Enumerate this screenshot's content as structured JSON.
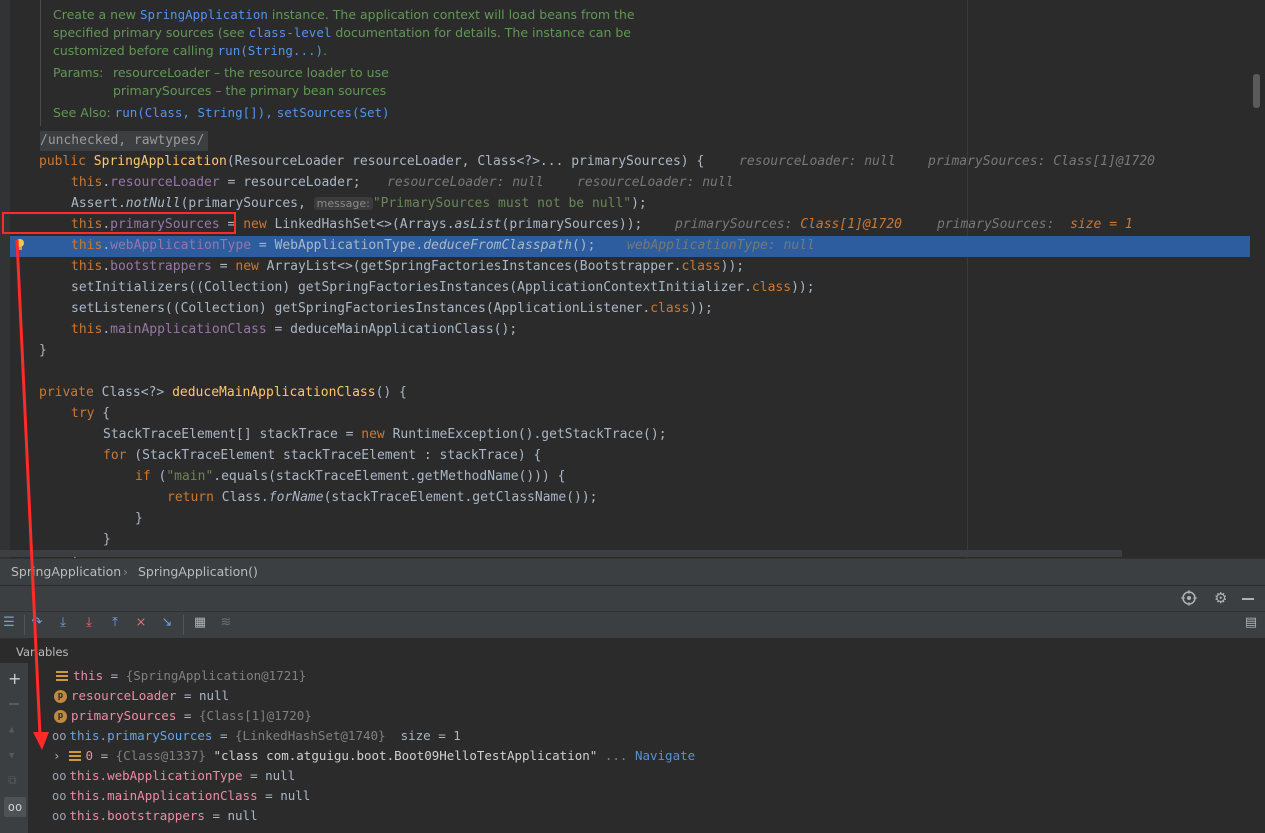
{
  "doc": {
    "line1": [
      "Create a new ",
      "SpringApplication",
      " instance. The application context will load beans from the"
    ],
    "line2": [
      "specified primary sources (see ",
      "class-level",
      " documentation for details. The instance can be"
    ],
    "line3": [
      "customized before calling ",
      "run(String...)",
      "."
    ],
    "params_label": "Params:",
    "param1": "resourceLoader – the resource loader to use",
    "param2": "primarySources – the primary bean sources",
    "see_also_label": "See Also:",
    "see_also_1": "run(Class, String[])",
    "see_also_sep": ",",
    "see_also_2": "setSources(Set)"
  },
  "code": {
    "annotation": "/unchecked, rawtypes/",
    "l1_kw": "public",
    "l1_name": "SpringApplication",
    "l1_rest": "(ResourceLoader resourceLoader, Class<?>... primarySources) {",
    "l1_hint1": "resourceLoader: null",
    "l1_hint2": "primarySources: Class[1]@1720",
    "l2_this": "this",
    "l2_field": "resourceLoader",
    "l2_rest": " = resourceLoader;",
    "l2_hint1": "resourceLoader: null",
    "l2_hint2": "resourceLoader: null",
    "l3_pre": "Assert.",
    "l3_fn": "notNull",
    "l3_mid": "(primarySources, ",
    "l3_param": "message:",
    "l3_str": "\"PrimarySources must not be null\"",
    "l3_end": ");",
    "l4_this": "this",
    "l4_field": "primarySources",
    "l4_eq": " = ",
    "l4_new": "new",
    "l4_mid": " LinkedHashSet<>(Arrays.",
    "l4_fn": "asList",
    "l4_end": "(primarySources));",
    "l4_hint1a": "primarySources: ",
    "l4_hint1b": "Class[1]@1720",
    "l4_hint2a": "primarySources: ",
    "l4_hint2b": "size = 1",
    "l5_this": "this",
    "l5_field": "webApplicationType",
    "l5_mid": " = WebApplicationType.",
    "l5_fn": "deduceFromClasspath",
    "l5_end": "();",
    "l5_hint": "webApplicationType: null",
    "l6_this": "this",
    "l6_field": "bootstrappers",
    "l6_eq": " = ",
    "l6_new": "new",
    "l6_mid": " ArrayList<>(getSpringFactoriesInstances(Bootstrapper.",
    "l6_cls": "class",
    "l6_end": "));",
    "l7_pre": "setInitializers((Collection) getSpringFactoriesInstances(ApplicationContextInitializer.",
    "l7_cls": "class",
    "l7_end": "));",
    "l8_pre": "setListeners((Collection) getSpringFactoriesInstances(ApplicationListener.",
    "l8_cls": "class",
    "l8_end": "));",
    "l9_this": "this",
    "l9_field": "mainApplicationClass",
    "l9_end": " = deduceMainApplicationClass();",
    "l10": "}",
    "l11_kw": "private",
    "l11_mid": " Class<?> ",
    "l11_fn": "deduceMainApplicationClass",
    "l11_end": "() {",
    "l12_kw": "try",
    "l12_end": " {",
    "l13_pre": "StackTraceElement[] stackTrace = ",
    "l13_new": "new",
    "l13_end": " RuntimeException().getStackTrace();",
    "l14_kw": "for",
    "l14_end": " (StackTraceElement stackTraceElement : stackTrace) {",
    "l15_kw": "if",
    "l15_p": " (",
    "l15_str": "\"main\"",
    "l15_end": ".equals(stackTraceElement.getMethodName())) {",
    "l16_kw": "return",
    "l16_mid": " Class.",
    "l16_fn": "forName",
    "l16_end": "(stackTraceElement.getClassName());",
    "l17": "}",
    "l18": "}",
    "l19": "}"
  },
  "breadcrumb": {
    "item1": "SpringApplication",
    "sep": "›",
    "item2": "SpringApplication()"
  },
  "variables": {
    "title": "Variables",
    "rows": [
      {
        "name": "this",
        "eq": " = ",
        "type": "{SpringApplication@1721}"
      },
      {
        "name": "resourceLoader",
        "eq": " = ",
        "value": "null"
      },
      {
        "name": "primarySources",
        "eq": " = ",
        "type": "{Class[1]@1720}"
      },
      {
        "name": "this.primarySources",
        "eq": " = ",
        "type": "{LinkedHashSet@1740}",
        "value": "size = 1"
      },
      {
        "name": "0",
        "eq": " = ",
        "type": "{Class@1337}",
        "value": "\"class com.atguigu.boot.Boot09HelloTestApplication\"",
        "more": "... ",
        "nav": "Navigate"
      },
      {
        "name": "this.webApplicationType",
        "eq": " = ",
        "value": "null"
      },
      {
        "name": "this.mainApplicationClass",
        "eq": " = ",
        "value": "null"
      },
      {
        "name": "this.bootstrappers",
        "eq": " = ",
        "value": "null"
      }
    ]
  },
  "colors": {
    "highlight": "#2d5d9f",
    "red_annotation": "#ff2a2a",
    "editor_bg": "#2b2b2b",
    "panel_bg": "#3c3f41"
  }
}
